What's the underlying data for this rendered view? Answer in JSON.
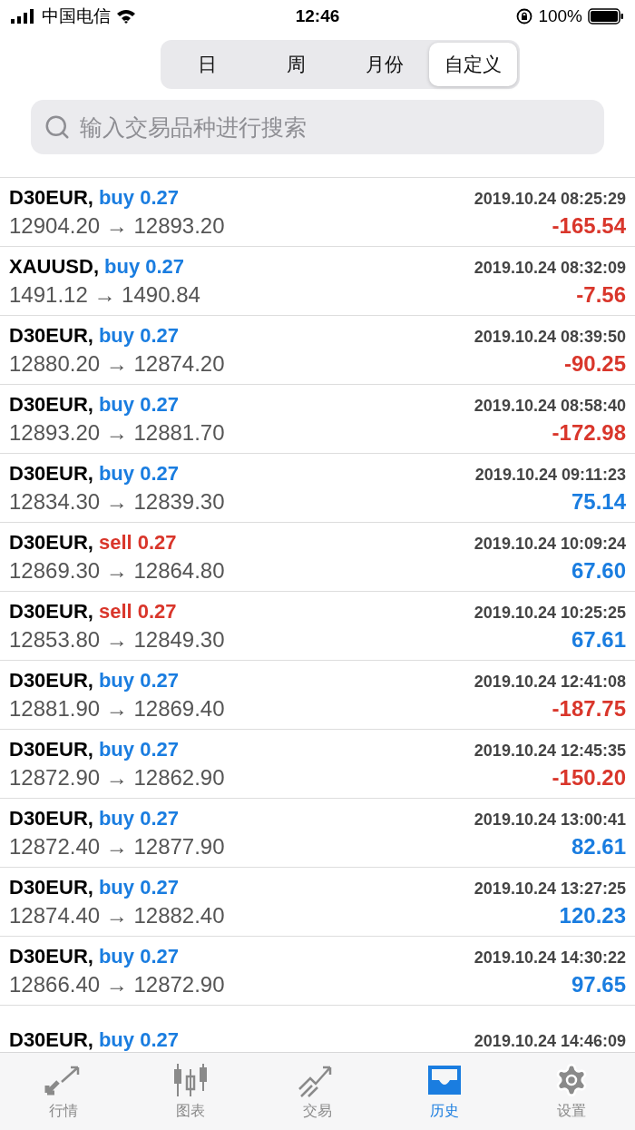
{
  "status_bar": {
    "carrier": "中国电信",
    "time": "12:46",
    "battery": "100%"
  },
  "period_tabs": [
    {
      "label": "日",
      "selected": false
    },
    {
      "label": "周",
      "selected": false
    },
    {
      "label": "月份",
      "selected": false
    },
    {
      "label": "自定义",
      "selected": true
    }
  ],
  "search": {
    "placeholder": "输入交易品种进行搜索"
  },
  "deals": [
    {
      "symbol": "D30EUR,",
      "order": {
        "text": "buy 0.27",
        "color": "#1a7de0"
      },
      "time": "2019.10.24 08:25:29",
      "prices": "12904.20 → 12893.20",
      "profit": {
        "text": "-165.54",
        "color": "#d9362b"
      }
    },
    {
      "symbol": "XAUUSD,",
      "order": {
        "text": "buy 0.27",
        "color": "#1a7de0"
      },
      "time": "2019.10.24 08:32:09",
      "prices": "1491.12 → 1490.84",
      "profit": {
        "text": "-7.56",
        "color": "#d9362b"
      }
    },
    {
      "symbol": "D30EUR,",
      "order": {
        "text": "buy 0.27",
        "color": "#1a7de0"
      },
      "time": "2019.10.24 08:39:50",
      "prices": "12880.20 → 12874.20",
      "profit": {
        "text": "-90.25",
        "color": "#d9362b"
      }
    },
    {
      "symbol": "D30EUR,",
      "order": {
        "text": "buy 0.27",
        "color": "#1a7de0"
      },
      "time": "2019.10.24 08:58:40",
      "prices": "12893.20 → 12881.70",
      "profit": {
        "text": "-172.98",
        "color": "#d9362b"
      }
    },
    {
      "symbol": "D30EUR,",
      "order": {
        "text": "buy 0.27",
        "color": "#1a7de0"
      },
      "time": "2019.10.24 09:11:23",
      "prices": "12834.30 → 12839.30",
      "profit": {
        "text": "75.14",
        "color": "#1a7de0"
      }
    },
    {
      "symbol": "D30EUR,",
      "order": {
        "text": "sell 0.27",
        "color": "#d9362b"
      },
      "time": "2019.10.24 10:09:24",
      "prices": "12869.30 → 12864.80",
      "profit": {
        "text": "67.60",
        "color": "#1a7de0"
      }
    },
    {
      "symbol": "D30EUR,",
      "order": {
        "text": "sell 0.27",
        "color": "#d9362b"
      },
      "time": "2019.10.24 10:25:25",
      "prices": "12853.80 → 12849.30",
      "profit": {
        "text": "67.61",
        "color": "#1a7de0"
      }
    },
    {
      "symbol": "D30EUR,",
      "order": {
        "text": "buy 0.27",
        "color": "#1a7de0"
      },
      "time": "2019.10.24 12:41:08",
      "prices": "12881.90 → 12869.40",
      "profit": {
        "text": "-187.75",
        "color": "#d9362b"
      }
    },
    {
      "symbol": "D30EUR,",
      "order": {
        "text": "buy 0.27",
        "color": "#1a7de0"
      },
      "time": "2019.10.24 12:45:35",
      "prices": "12872.90 → 12862.90",
      "profit": {
        "text": "-150.20",
        "color": "#d9362b"
      }
    },
    {
      "symbol": "D30EUR,",
      "order": {
        "text": "buy 0.27",
        "color": "#1a7de0"
      },
      "time": "2019.10.24 13:00:41",
      "prices": "12872.40 → 12877.90",
      "profit": {
        "text": "82.61",
        "color": "#1a7de0"
      }
    },
    {
      "symbol": "D30EUR,",
      "order": {
        "text": "buy 0.27",
        "color": "#1a7de0"
      },
      "time": "2019.10.24 13:27:25",
      "prices": "12874.40 → 12882.40",
      "profit": {
        "text": "120.23",
        "color": "#1a7de0"
      }
    },
    {
      "symbol": "D30EUR,",
      "order": {
        "text": "buy 0.27",
        "color": "#1a7de0"
      },
      "time": "2019.10.24 14:30:22",
      "prices": "12866.40 → 12872.90",
      "profit": {
        "text": "97.65",
        "color": "#1a7de0"
      }
    },
    {
      "symbol": "D30EUR,",
      "order": {
        "text": "buy 0.27",
        "color": "#1a7de0"
      },
      "time": "2019.10.24 14:46:09"
    }
  ],
  "tab_bar": [
    {
      "label": "行情",
      "kind": "quotes",
      "selected": false
    },
    {
      "label": "图表",
      "kind": "chart",
      "selected": false
    },
    {
      "label": "交易",
      "kind": "trade",
      "selected": false
    },
    {
      "label": "历史",
      "kind": "history",
      "selected": true
    },
    {
      "label": "设置",
      "kind": "settings",
      "selected": false
    }
  ]
}
